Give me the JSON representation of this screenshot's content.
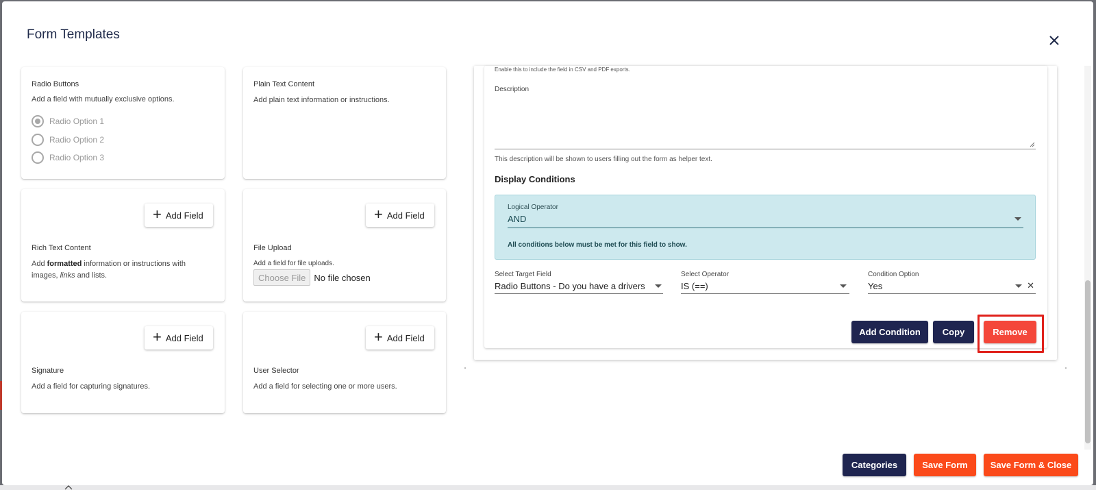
{
  "dialog": {
    "title": "Form Templates",
    "close_icon": "close-icon"
  },
  "palette": {
    "radio_buttons": {
      "title": "Radio Buttons",
      "description": "Add a field with mutually exclusive options.",
      "options": [
        "Radio Option 1",
        "Radio Option 2",
        "Radio Option 3"
      ],
      "selected_index": 0
    },
    "plain_text": {
      "title": "Plain Text Content",
      "description": "Add plain text information or instructions."
    },
    "rich_text": {
      "button_label": "Add Field",
      "title": "Rich Text Content",
      "desc_part1": "Add ",
      "desc_bold": "formatted",
      "desc_part2": " information or instructions with",
      "desc_line2_part1": "images, ",
      "desc_italic": "links",
      "desc_line2_part2": " and lists."
    },
    "file_upload": {
      "button_label": "Add Field",
      "title": "File Upload",
      "description": "Add a field for file uploads.",
      "choose_label": "Choose File",
      "no_file_label": "No file chosen"
    },
    "signature": {
      "button_label": "Add Field",
      "title": "Signature",
      "description": "Add a field for capturing signatures."
    },
    "user_selector": {
      "button_label": "Add Field",
      "title": "User Selector",
      "description": "Add a field for selecting one or more users."
    }
  },
  "editor": {
    "export_helper": "Enable this to include the field in CSV and PDF exports.",
    "description_label": "Description",
    "description_value": "",
    "description_helper": "This description will be shown to users filling out the form as helper text.",
    "display_conditions_title": "Display Conditions",
    "logical_operator": {
      "label": "Logical Operator",
      "value": "AND",
      "note": "All conditions below must be met for this field to show."
    },
    "condition": {
      "target_label": "Select Target Field",
      "target_value": "Radio Buttons - Do you have a drivers licence?",
      "operator_label": "Select Operator",
      "operator_value": "IS (==)",
      "option_label": "Condition Option",
      "option_value": "Yes"
    },
    "add_condition_label": "Add Condition",
    "copy_label": "Copy",
    "remove_label": "Remove"
  },
  "footer": {
    "categories_label": "Categories",
    "save_label": "Save Form",
    "save_close_label": "Save Form & Close"
  },
  "colors": {
    "navy": "#1f2550",
    "orange": "#fb4a1a",
    "remove_red": "#f4473a",
    "highlight": "#e0211b",
    "condition_bg": "#cde9ee"
  }
}
